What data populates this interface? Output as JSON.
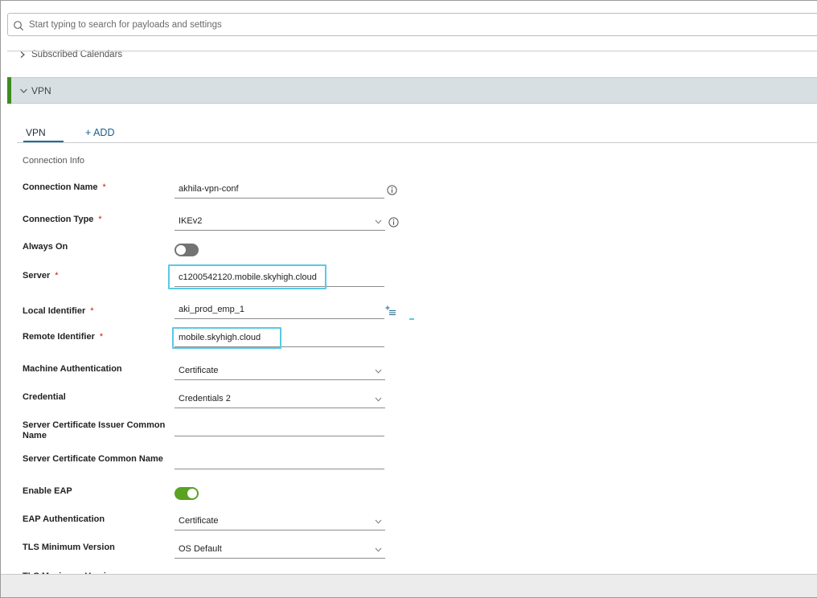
{
  "search": {
    "placeholder": "Start typing to search for payloads and settings"
  },
  "sections": {
    "subscribed_calendars": "Subscribed Calendars",
    "vpn": "VPN"
  },
  "tabs": {
    "vpn": "VPN",
    "add": "+ ADD"
  },
  "group_title": "Connection Info",
  "required_mark": "*",
  "fields": {
    "connection_name": {
      "label": "Connection Name",
      "value": "akhila-vpn-conf"
    },
    "connection_type": {
      "label": "Connection Type",
      "value": "IKEv2"
    },
    "always_on": {
      "label": "Always On",
      "state": "off"
    },
    "server": {
      "label": "Server",
      "value": "c1200542120.mobile.skyhigh.cloud"
    },
    "local_identifier": {
      "label": "Local Identifier",
      "value": "aki_prod_emp_1"
    },
    "remote_identifier": {
      "label": "Remote Identifier",
      "value": "mobile.skyhigh.cloud"
    },
    "machine_authentication": {
      "label": "Machine Authentication",
      "value": "Certificate"
    },
    "credential": {
      "label": "Credential",
      "value": "Credentials 2"
    },
    "server_cert_issuer_cn": {
      "label_line1": "Server Certificate Issuer Common",
      "label_line2": "Name",
      "value": ""
    },
    "server_cert_cn": {
      "label": "Server Certificate Common Name",
      "value": ""
    },
    "enable_eap": {
      "label": "Enable EAP",
      "state": "on"
    },
    "eap_authentication": {
      "label": "EAP Authentication",
      "value": "Certificate"
    },
    "tls_min_version": {
      "label": "TLS Minimum Version",
      "value": "OS Default"
    },
    "tls_max_version": {
      "label": "TLS Maximum Version"
    }
  },
  "icons": {
    "search": "search-icon",
    "info": "info-icon",
    "caret": "chevron-down-icon",
    "insert_lookup": "insert-lookup-icon"
  },
  "colors": {
    "accent_green": "#3d8c1e",
    "tab_underline": "#1b6fa1",
    "highlight": "#5bc8e6",
    "toggle_on": "#5aa220",
    "required": "#c92100"
  }
}
